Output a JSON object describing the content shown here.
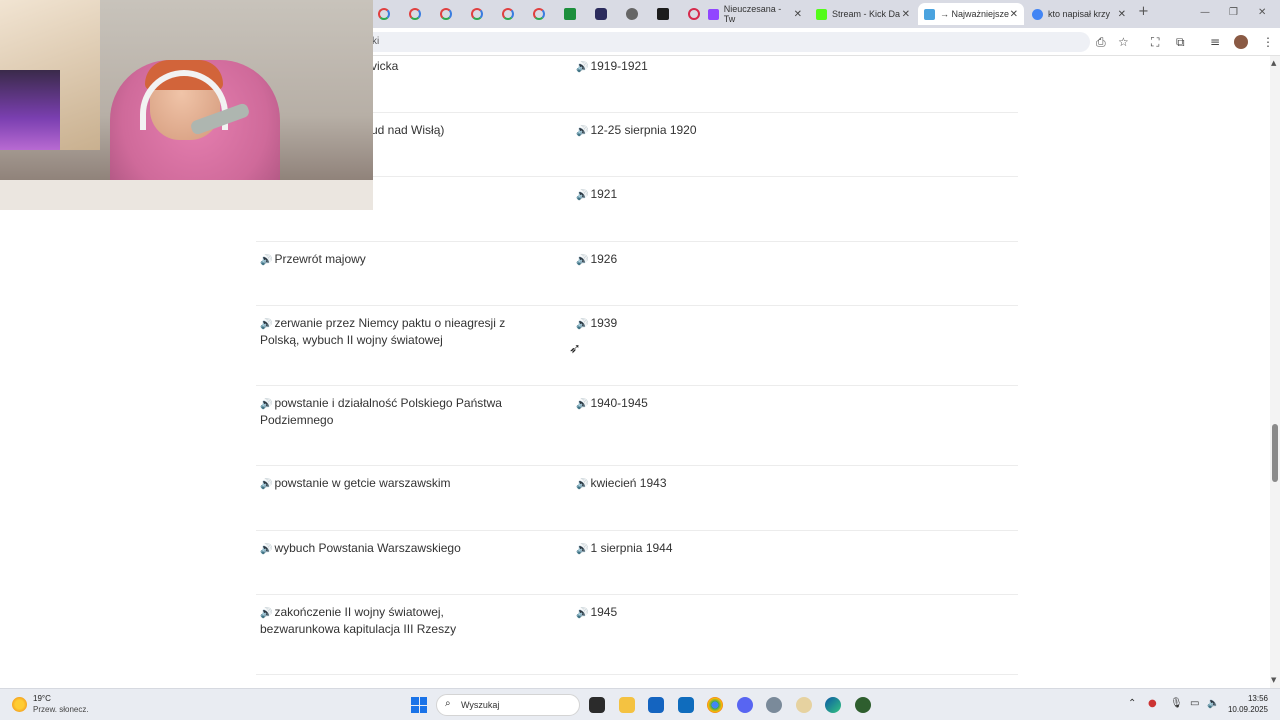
{
  "browser": {
    "tabs": [
      {
        "title": "Nieuczesana - Tw",
        "color": "#9146ff"
      },
      {
        "title": "Stream - Kick Da",
        "color": "#53fc18"
      },
      {
        "title": "→ Najważniejsze",
        "color": "#4aa3df"
      },
      {
        "title": "kto napisał krzy",
        "color": "#4285f4"
      }
    ],
    "address": "ki",
    "new_tab": "+"
  },
  "rows": [
    {
      "event": "vicka",
      "date": "1919-1921"
    },
    {
      "event": "ud nad Wisłą)",
      "date": "12-25 sierpnia 1920"
    },
    {
      "event": "",
      "date": "1921"
    },
    {
      "event": "Przewrót majowy",
      "date": "1926"
    },
    {
      "event": "zerwanie przez Niemcy paktu o nieagresji z Polską, wybuch II wojny światowej",
      "date": "1939"
    },
    {
      "event": "powstanie i działalność Polskiego Państwa Podziemnego",
      "date": "1940-1945"
    },
    {
      "event": "powstanie w getcie warszawskim",
      "date": "kwiecień 1943"
    },
    {
      "event": "wybuch Powstania Warszawskiego",
      "date": "1 sierpnia 1944"
    },
    {
      "event": "zakończenie II wojny światowej, bezwarunkowa kapitulacja III Rzeszy",
      "date": "1945"
    }
  ],
  "taskbar": {
    "weather_temp": "19°C",
    "weather_desc": "Przew. słonecz.",
    "search_placeholder": "Wyszukaj",
    "time": "13:56",
    "date": "10.09.2025"
  }
}
